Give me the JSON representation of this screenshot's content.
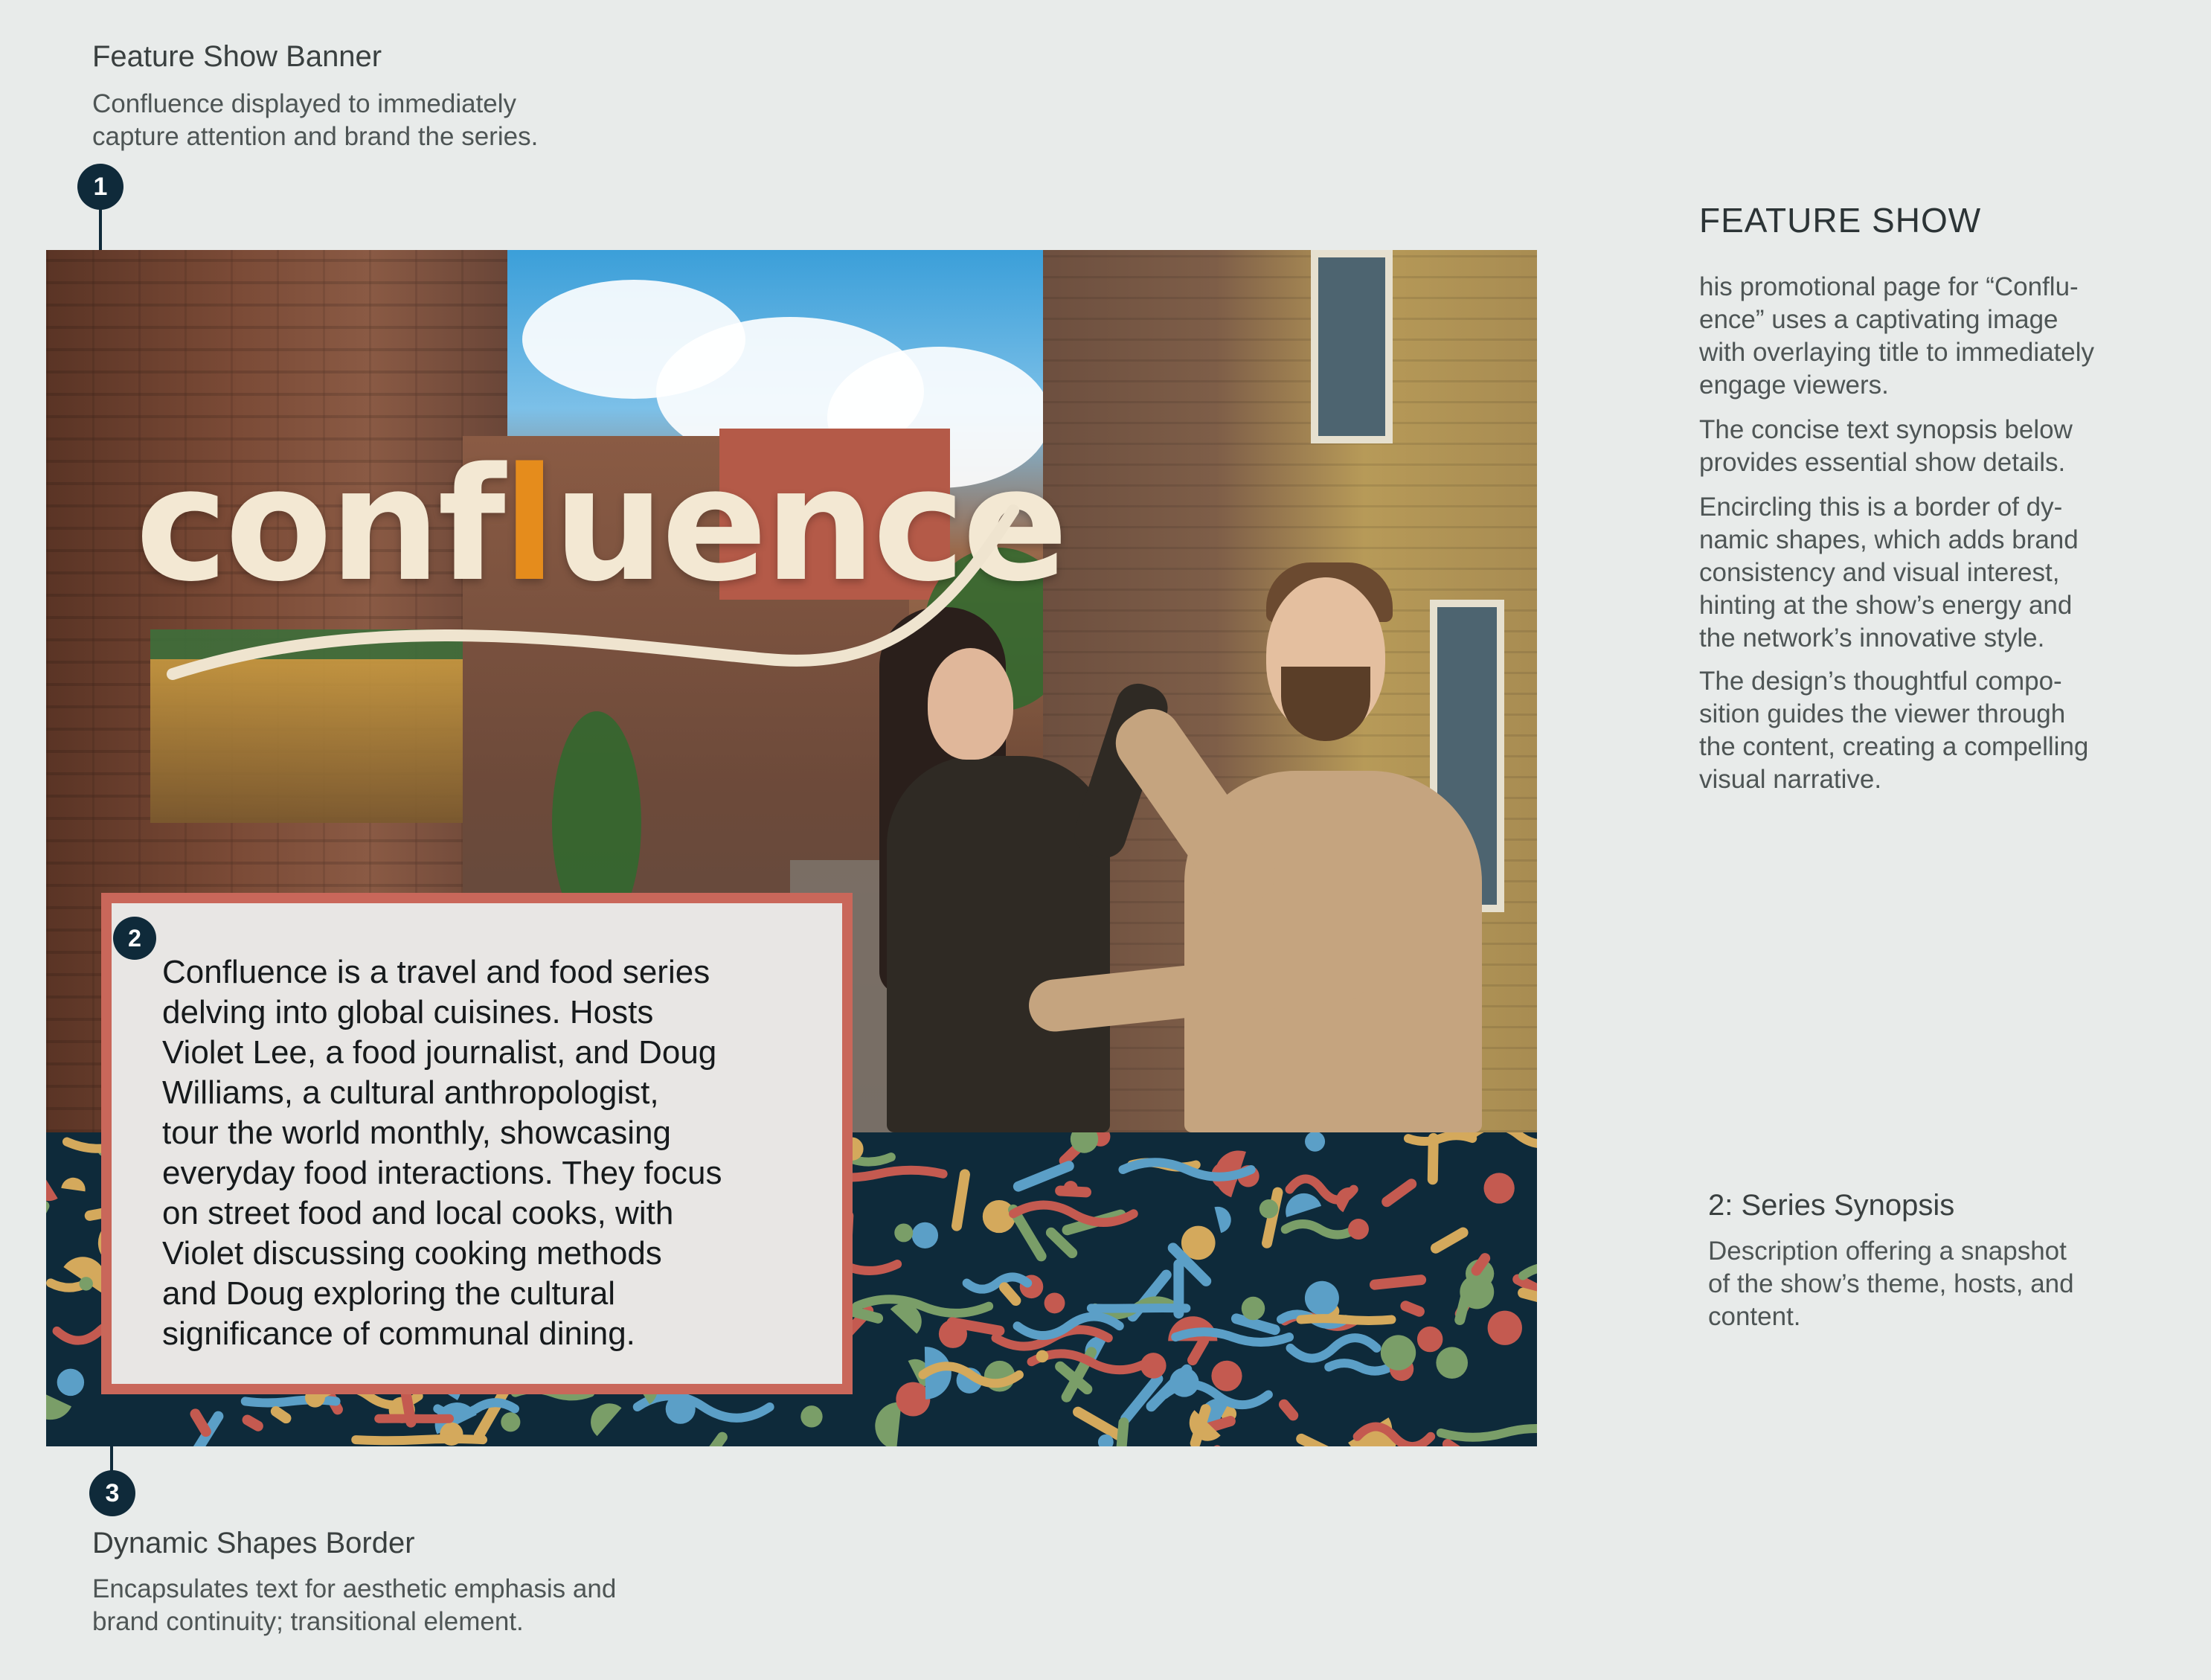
{
  "annotations": {
    "banner": {
      "number": "1",
      "title": "Feature Show Banner",
      "desc_line1": "Confluence  displayed to immediately",
      "desc_line2": "capture attention and brand the series."
    },
    "synopsis": {
      "number": "2",
      "title": "2: Series Synopsis",
      "desc_line1": "Description offering a snapshot",
      "desc_line2": "of the show’s theme, hosts, and",
      "desc_line3": "content."
    },
    "shapes": {
      "number": "3",
      "title": "Dynamic Shapes Border",
      "desc_line1": "Encapsulates text for aesthetic emphasis and",
      "desc_line2": "brand continuity; transitional element."
    }
  },
  "logo": {
    "part1": "conf",
    "accent": "l",
    "part2": "uence",
    "accent_color": "#e58c1c",
    "text_color": "#f3e8d3"
  },
  "synopsis_text": [
    "Confluence is a travel and food series",
    "delving into global cuisines. Hosts",
    "Violet Lee, a food journalist, and Doug",
    "Williams, a cultural anthropologist,",
    "tour the world monthly, showcasing",
    "everyday food interactions. They focus",
    "on street food and local cooks, with",
    "Violet discussing cooking methods",
    "and Doug exploring the cultural",
    "significance of communal dining."
  ],
  "feature_show": {
    "heading": "FEATURE SHOW",
    "para1": [
      "his promotional page for “Conflu-",
      "ence” uses a captivating image",
      "with overlaying title to immediately",
      "engage viewers."
    ],
    "para2": [
      "The concise text synopsis below",
      "provides essential show details."
    ],
    "para3": [
      "Encircling this is a border of dy-",
      "namic shapes, which adds brand",
      "consistency and visual interest,",
      "hinting at the show’s energy and",
      "the network’s innovative style."
    ],
    "para4": [
      "The design’s thoughtful compo-",
      "sition guides the viewer through",
      "the content, creating a compelling",
      "visual narrative."
    ]
  },
  "colors": {
    "background": "#e8ebea",
    "marker": "#0f2a3a",
    "band": "#0e2a3a",
    "box_border": "#c9675a",
    "shape_palette": [
      "#c45a50",
      "#d4a95c",
      "#5b9fc7",
      "#7a9e68"
    ]
  }
}
